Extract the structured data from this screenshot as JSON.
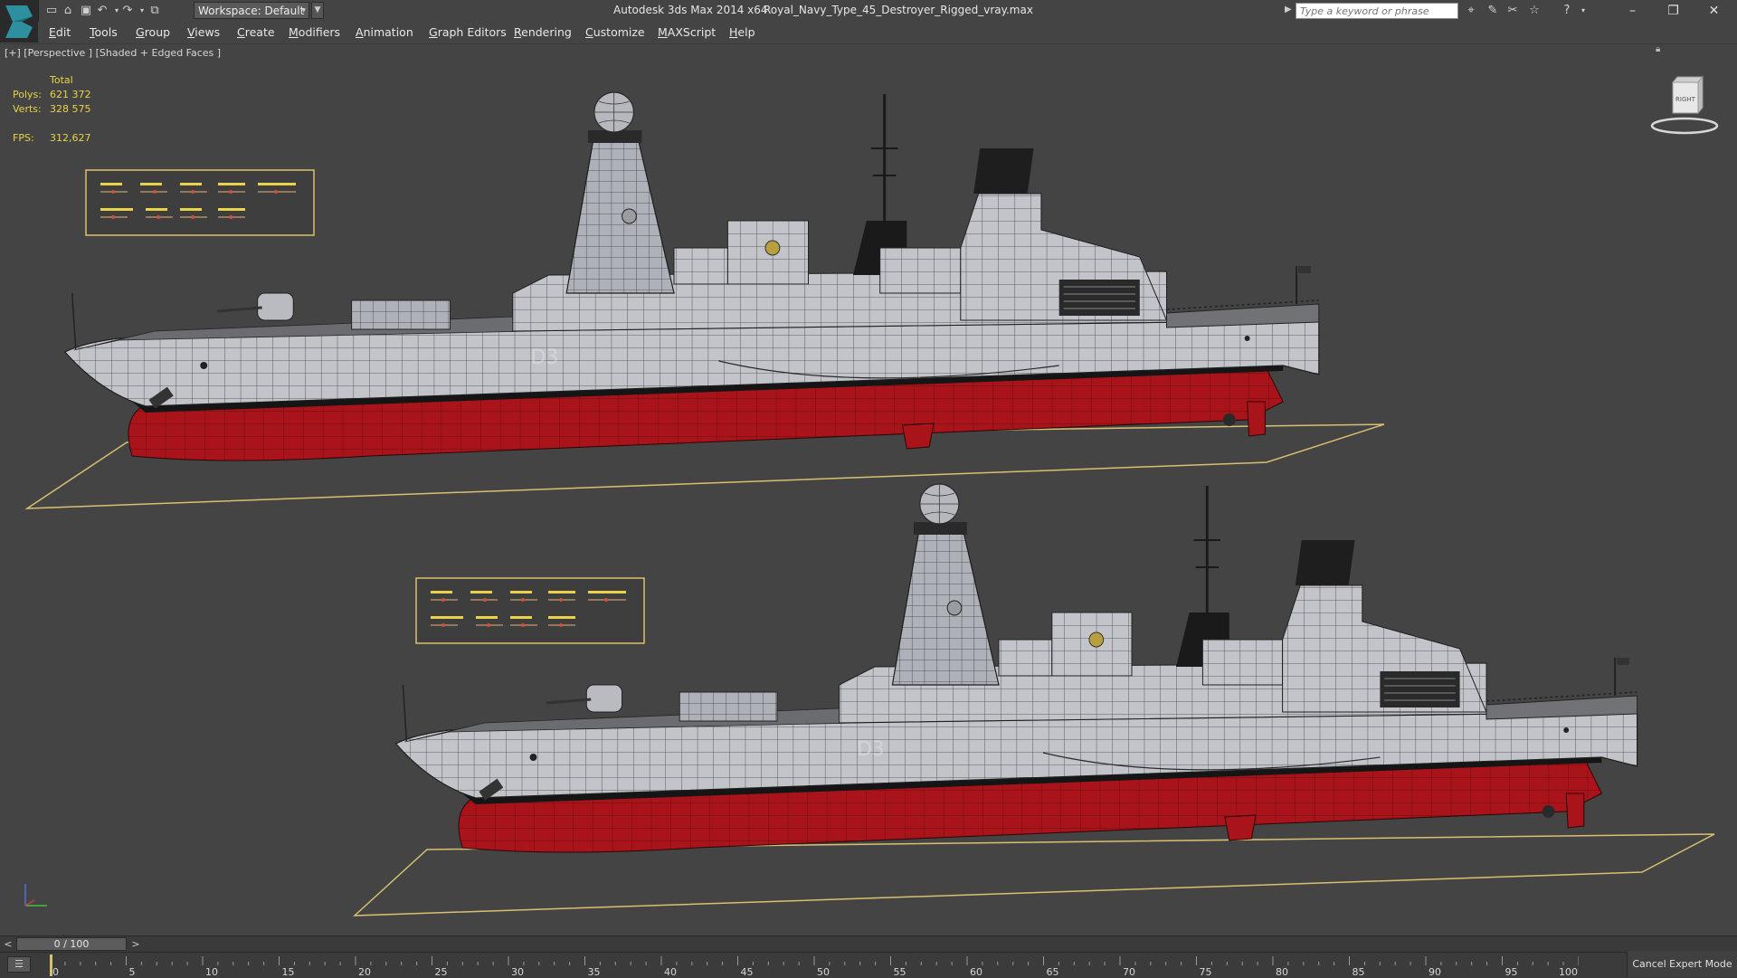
{
  "titlebar": {
    "workspace_label": "Workspace: Default",
    "app_title": "Autodesk 3ds Max  2014 x64",
    "file_name": "Royal_Navy_Type_45_Destroyer_Rigged_vray.max",
    "search_placeholder": "Type a keyword or phrase"
  },
  "menu": {
    "items": [
      "Edit",
      "Tools",
      "Group",
      "Views",
      "Create",
      "Modifiers",
      "Animation",
      "Graph Editors",
      "Rendering",
      "Customize",
      "MAXScript",
      "Help"
    ]
  },
  "viewport": {
    "label": "[+] [Perspective ] [Shaded + Edged Faces ]",
    "stats": {
      "header": "Total",
      "polys_label": "Polys:",
      "polys_value": "621 372",
      "verts_label": "Verts:",
      "verts_value": "328 575",
      "fps_label": "FPS:",
      "fps_value": "312,627"
    },
    "viewcube_face": "RIGHT"
  },
  "timeline": {
    "slider_label": "0 / 100",
    "ticks": [
      "0",
      "5",
      "10",
      "15",
      "20",
      "25",
      "30",
      "35",
      "40",
      "45",
      "50",
      "55",
      "60",
      "65",
      "70",
      "75",
      "80",
      "85",
      "90",
      "95",
      "100"
    ],
    "cancel_expert_label": "Cancel Expert Mode"
  },
  "colors": {
    "ui_bg": "#444444",
    "stat_text": "#e8d34a",
    "hull_grey": "#c4c6cb",
    "hull_red": "#a8141a",
    "boot_black": "#1a1a1a",
    "bounding_box": "#d8c070",
    "logo_teal": "#2d8fa0"
  }
}
